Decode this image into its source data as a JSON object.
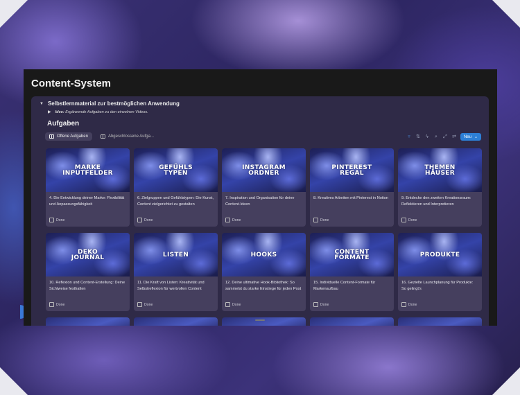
{
  "page": {
    "title": "Content-System"
  },
  "toggle": {
    "title": "Selbstlernmaterial zur bestmöglichen Anwendung",
    "idea_label": "Idee:",
    "idea_text": "Ergänzende Aufgaben zu den einzelnen Videos."
  },
  "database": {
    "title": "Aufgaben",
    "views": [
      {
        "label": "Offene Aufgaben",
        "active": true
      },
      {
        "label": "Abgeschlossene Aufga...",
        "active": false
      }
    ],
    "toolbar_icons": [
      "filter-icon",
      "sort-icon",
      "lightning-icon",
      "search-icon",
      "expand-icon",
      "settings-icon"
    ],
    "new_label": "Neu"
  },
  "cards": [
    {
      "cover": "MARKE\nINPUTFELDER",
      "title": "4. Die Entwicklung deiner Marke: Flexibilität und Anpassungsfähigkeit",
      "checkbox": "Done"
    },
    {
      "cover": "GEFÜHLS\nTYPEN",
      "title": "6. Zielgruppen und Gefühlstypen: Die Kunst, Content zielgerichtet zu gestalten",
      "checkbox": "Done"
    },
    {
      "cover": "INSTAGRAM\nORDNER",
      "title": "7. Inspiration und Organisation für deine Content-Ideen",
      "checkbox": "Done"
    },
    {
      "cover": "PINTEREST\nREGAL",
      "title": "8. Kreatives Arbeiten mit Pinterest in Notion",
      "checkbox": "Done"
    },
    {
      "cover": "THEMEN\nHÄUSER",
      "title": "9. Entdecke den zweiten Kreationsraum: Reflektieren und Interpretieren",
      "checkbox": "Done"
    },
    {
      "cover": "DEKO\nJOURNAL",
      "title": "10. Reflexion und Content-Erstellung: Deine Sichtweise festhalten",
      "checkbox": "Done"
    },
    {
      "cover": "LISTEN",
      "title": "11. Die Kraft von Listen: Kreativität und Selbstreflexion für wertvollen Content",
      "checkbox": "Done"
    },
    {
      "cover": "HOOKS",
      "title": "12. Deine ultimative Hook-Bibliothek: So sammelst du starke Einstiege für jeden Post",
      "checkbox": "Done"
    },
    {
      "cover": "CONTENT\nFORMATE",
      "title": "15. Individuelle Content-Formate für Markenaufbau",
      "checkbox": "Done"
    },
    {
      "cover": "PRODUKTE",
      "title": "16. Gezielte Launchplanung für Produkte: So gelingt's",
      "checkbox": "Done"
    }
  ]
}
